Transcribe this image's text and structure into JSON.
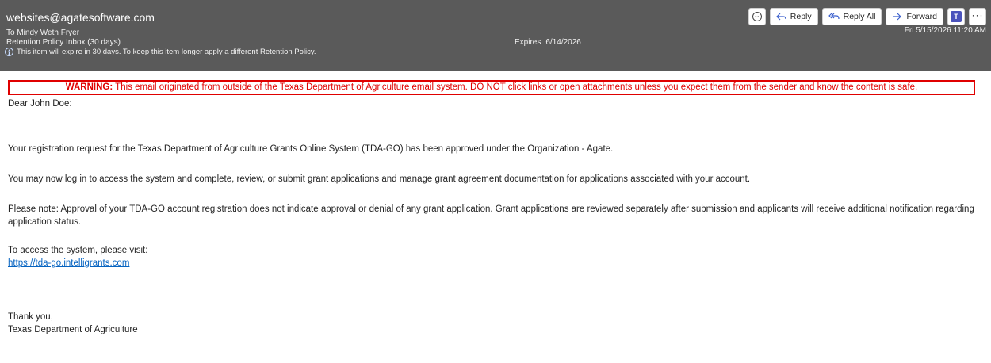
{
  "header": {
    "sender": "websites@agatesoftware.com",
    "to_label": "To",
    "to_name": "Mindy Weth Fryer",
    "retention_label": "Retention Policy",
    "retention_value": "Inbox (30 days)",
    "expiry_note": "This item will expire in 30 days. To keep this item longer apply a different Retention Policy.",
    "expires_label": "Expires",
    "expires_date": "6/14/2026",
    "datetime": "Fri 5/15/2026 11:20 AM",
    "background_color": "#5a5a5a"
  },
  "toolbar": {
    "emoji_icon": "smiley-icon",
    "reply_label": "Reply",
    "reply_all_label": "Reply All",
    "forward_label": "Forward",
    "teams_icon": "teams-icon",
    "more_icon": "more-icon"
  },
  "warning": {
    "prefix": "WARNING:",
    "text": " This email originated from outside of the Texas Department of Agriculture email system. DO NOT click links or open attachments unless you expect them from the sender and know the content is safe.",
    "color": "#e00000"
  },
  "body": {
    "greeting": "Dear John Doe:",
    "paragraph1": "Your registration request for the Texas Department of Agriculture Grants Online System (TDA-GO) has been approved under the Organization - Agate.",
    "paragraph2": "You may now log in to access the system and complete, review, or submit grant applications and manage grant agreement documentation for applications associated with your account.",
    "paragraph3": "Please note: Approval of your TDA-GO account registration does not indicate approval or denial of any grant application. Grant applications are reviewed separately after submission and applicants will receive additional notification regarding application status.",
    "access_text": "To access the system, please visit:",
    "link": "https://tda-go.intelligrants.com",
    "closing": "Thank you,",
    "signature": "Texas Department of Agriculture",
    "link_color": "#0563c1"
  }
}
